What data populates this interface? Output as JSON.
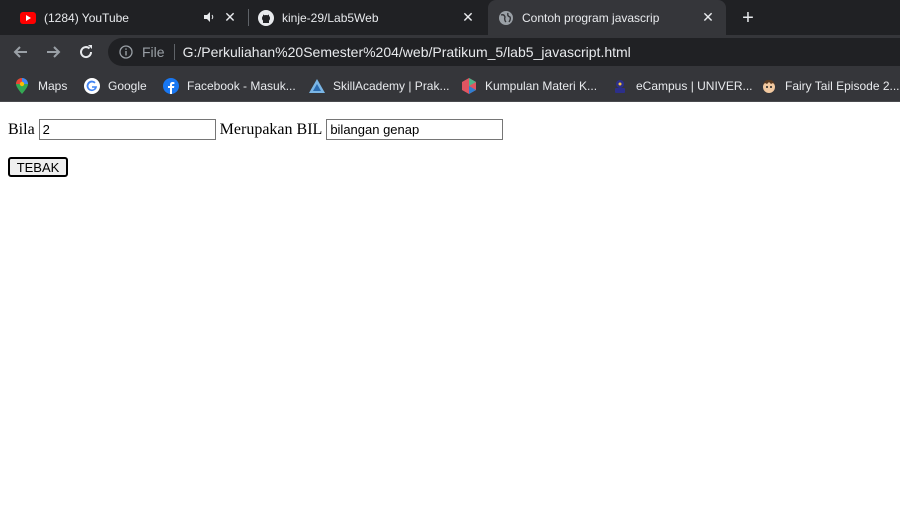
{
  "browser": {
    "tabs": [
      {
        "title": "(1284) YouTube",
        "icon": "youtube-icon",
        "audio_icon": "speaker-icon"
      },
      {
        "title": "kinje-29/Lab5Web",
        "icon": "github-icon"
      },
      {
        "title": "Contoh program javascrip",
        "icon": "globe-icon",
        "active": true
      }
    ],
    "new_tab_label": "+",
    "close_glyph": "✕",
    "address": {
      "scheme_label": "File",
      "url": "G:/Perkuliahan%20Semester%204/web/Pratikum_5/lab5_javascript.html"
    },
    "bookmarks": [
      {
        "label": "Maps",
        "icon": "maps-icon"
      },
      {
        "label": "Google",
        "icon": "google-icon"
      },
      {
        "label": "Facebook - Masuk...",
        "icon": "facebook-icon"
      },
      {
        "label": "SkillAcademy | Prak...",
        "icon": "skillacademy-icon"
      },
      {
        "label": "Kumpulan Materi K...",
        "icon": "materi-icon"
      },
      {
        "label": "eCampus | UNIVER...",
        "icon": "ecampus-icon"
      },
      {
        "label": "Fairy Tail Episode 2...",
        "icon": "fairytail-icon"
      }
    ]
  },
  "form": {
    "label_bila": "Bila",
    "input_a_value": "2",
    "label_merupakan": "Merupakan BIL",
    "input_b_value": "bilangan genap",
    "button_label": "TEBAK"
  },
  "colors": {
    "tabstrip_bg": "#202124",
    "toolbar_bg": "#35363a",
    "omnibox_bg": "#202124",
    "text_light": "#e8eaed",
    "youtube_red": "#ff0000"
  }
}
